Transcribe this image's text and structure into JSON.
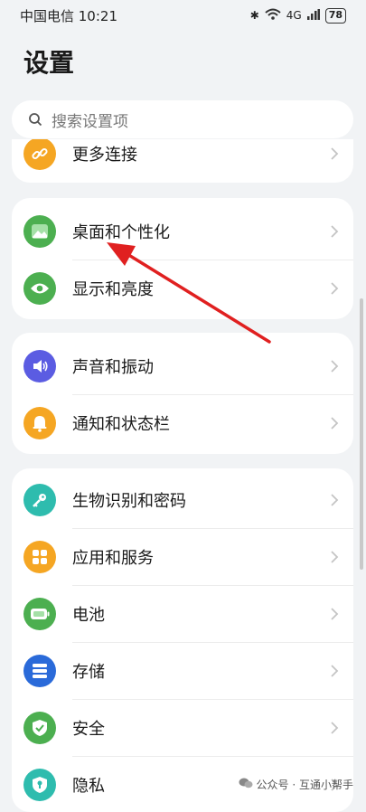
{
  "status": {
    "carrier_time": "中国电信 10:21",
    "network": "4G",
    "battery": "78"
  },
  "page": {
    "title": "设置"
  },
  "search": {
    "placeholder": "搜索设置项"
  },
  "items": [
    {
      "label": "更多连接",
      "icon": "link-icon",
      "color": "#f5a623"
    },
    {
      "label": "桌面和个性化",
      "icon": "wallpaper-icon",
      "color": "#4caf50"
    },
    {
      "label": "显示和亮度",
      "icon": "eye-icon",
      "color": "#4caf50"
    },
    {
      "label": "声音和振动",
      "icon": "speaker-icon",
      "color": "#5b5ce2"
    },
    {
      "label": "通知和状态栏",
      "icon": "bell-icon",
      "color": "#f5a623"
    },
    {
      "label": "生物识别和密码",
      "icon": "key-icon",
      "color": "#2ebcae"
    },
    {
      "label": "应用和服务",
      "icon": "apps-icon",
      "color": "#f5a623"
    },
    {
      "label": "电池",
      "icon": "battery-icon",
      "color": "#4caf50"
    },
    {
      "label": "存储",
      "icon": "storage-icon",
      "color": "#2a6ad9"
    },
    {
      "label": "安全",
      "icon": "shield-icon",
      "color": "#4caf50"
    },
    {
      "label": "隐私",
      "icon": "privacy-icon",
      "color": "#2ebcae"
    }
  ],
  "watermark": {
    "text": "公众号 · 互通小帮手"
  }
}
